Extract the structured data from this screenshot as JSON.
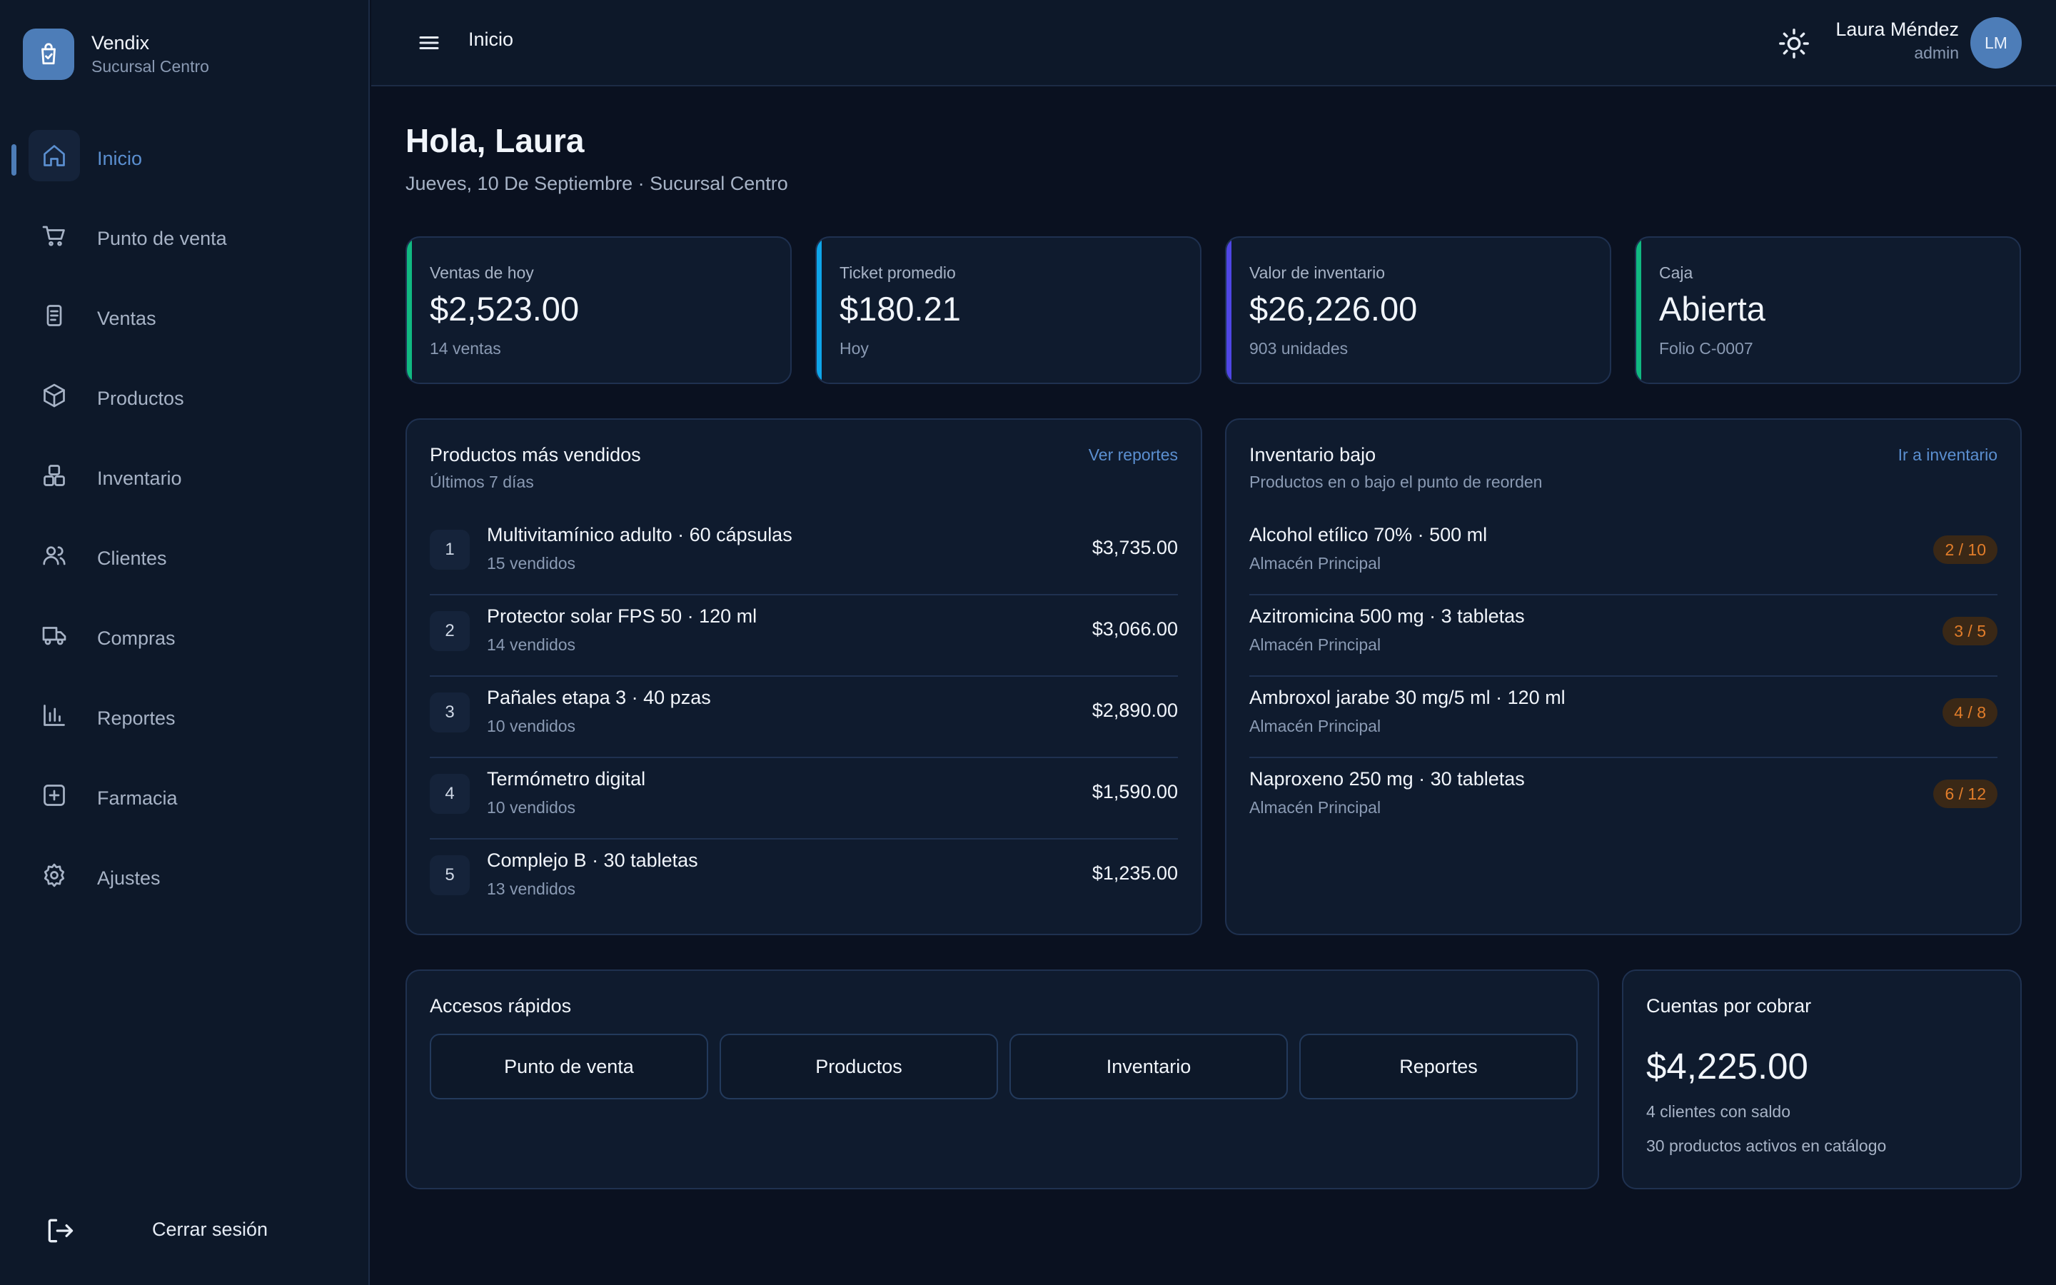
{
  "brand": {
    "name": "Vendix",
    "branch": "Sucursal Centro"
  },
  "nav": [
    {
      "label": "Inicio",
      "icon": "home-icon",
      "active": true
    },
    {
      "label": "Punto de venta",
      "icon": "cart-icon"
    },
    {
      "label": "Ventas",
      "icon": "receipt-icon"
    },
    {
      "label": "Productos",
      "icon": "box-icon"
    },
    {
      "label": "Inventario",
      "icon": "grid-icon"
    },
    {
      "label": "Clientes",
      "icon": "users-icon"
    },
    {
      "label": "Compras",
      "icon": "truck-icon"
    },
    {
      "label": "Reportes",
      "icon": "bar-chart-icon"
    },
    {
      "label": "Farmacia",
      "icon": "plus-square-icon"
    },
    {
      "label": "Ajustes",
      "icon": "gear-icon"
    }
  ],
  "logout": {
    "label": "Cerrar sesión"
  },
  "topbar": {
    "breadcrumb": "Inicio"
  },
  "user": {
    "name": "Laura Méndez",
    "role": "admin",
    "initials": "LM"
  },
  "greeting": {
    "title": "Hola, Laura",
    "subtitle": "Jueves, 10 De Septiembre · Sucursal Centro"
  },
  "kpis": [
    {
      "label": "Ventas de hoy",
      "value": "$2,523.00",
      "sub": "14 ventas",
      "color": "#10b981"
    },
    {
      "label": "Ticket promedio",
      "value": "$180.21",
      "sub": "Hoy",
      "color": "#0ea5e9"
    },
    {
      "label": "Valor de inventario",
      "value": "$26,226.00",
      "sub": "903 unidades",
      "color": "#4f46e5"
    },
    {
      "label": "Caja",
      "value": "Abierta",
      "sub": "Folio C-0007",
      "color": "#10b981"
    }
  ],
  "top_products": {
    "title": "Productos más vendidos",
    "subtitle": "Últimos 7 días",
    "link": "Ver reportes",
    "items": [
      {
        "rank": "1",
        "name": "Multivitamínico adulto · 60 cápsulas",
        "sold": "15 vendidos",
        "amount": "$3,735.00"
      },
      {
        "rank": "2",
        "name": "Protector solar FPS 50 · 120 ml",
        "sold": "14 vendidos",
        "amount": "$3,066.00"
      },
      {
        "rank": "3",
        "name": "Pañales etapa 3 · 40 pzas",
        "sold": "10 vendidos",
        "amount": "$2,890.00"
      },
      {
        "rank": "4",
        "name": "Termómetro digital",
        "sold": "10 vendidos",
        "amount": "$1,590.00"
      },
      {
        "rank": "5",
        "name": "Complejo B · 30 tabletas",
        "sold": "13 vendidos",
        "amount": "$1,235.00"
      }
    ]
  },
  "low_stock": {
    "title": "Inventario bajo",
    "subtitle": "Productos en o bajo el punto de reorden",
    "link": "Ir a inventario",
    "items": [
      {
        "name": "Alcohol etílico 70% · 500 ml",
        "location": "Almacén Principal",
        "stock": "2 / 10"
      },
      {
        "name": "Azitromicina 500 mg · 3 tabletas",
        "location": "Almacén Principal",
        "stock": "3 / 5"
      },
      {
        "name": "Ambroxol jarabe 30 mg/5 ml · 120 ml",
        "location": "Almacén Principal",
        "stock": "4 / 8"
      },
      {
        "name": "Naproxeno 250 mg · 30 tabletas",
        "location": "Almacén Principal",
        "stock": "6 / 12"
      }
    ]
  },
  "quick_access": {
    "title": "Accesos rápidos",
    "buttons": [
      "Punto de venta",
      "Productos",
      "Inventario",
      "Reportes"
    ]
  },
  "receivables": {
    "title": "Cuentas por cobrar",
    "value": "$4,225.00",
    "clients": "4 clientes con saldo",
    "products": "30 productos activos en catálogo"
  }
}
